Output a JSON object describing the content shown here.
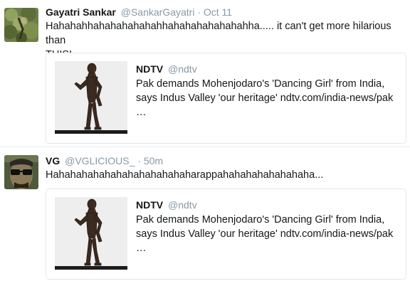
{
  "tweets": [
    {
      "user": {
        "name": "Gayatri Sankar",
        "handle": "@SankarGayatri",
        "avatar_icon": "green-foliage-avatar"
      },
      "separator": "·",
      "time": "Oct 11",
      "text_lines": [
        "Hahahahhahahahahahahhahahahahahahahha..... it can't get more hilarious than",
        "THIS!"
      ],
      "card": {
        "name": "NDTV",
        "handle": "@ndtv",
        "thumbnail_icon": "dancing-girl-statue-icon",
        "text_lines": [
          "Pak demands Mohenjodaro's 'Dancing Girl' from India,",
          "says Indus Valley 'our heritage' ndtv.com/india-news/pak",
          "…"
        ]
      }
    },
    {
      "user": {
        "name": "VG",
        "handle": "@VGLICIOUS_",
        "avatar_icon": "sunglasses-face-avatar"
      },
      "separator": "·",
      "time": "50m",
      "text_lines": [
        "Hahahahahahahahahahahahaharappahahahahahahahaha..."
      ],
      "card": {
        "name": "NDTV",
        "handle": "@ndtv",
        "thumbnail_icon": "dancing-girl-statue-icon",
        "text_lines": [
          "Pak demands Mohenjodaro's 'Dancing Girl' from India,",
          "says Indus Valley 'our heritage' ndtv.com/india-news/pak",
          "…"
        ]
      }
    }
  ],
  "colors": {
    "meta_gray": "#8899a6",
    "text": "#14171a",
    "border": "#e1e8ed"
  }
}
